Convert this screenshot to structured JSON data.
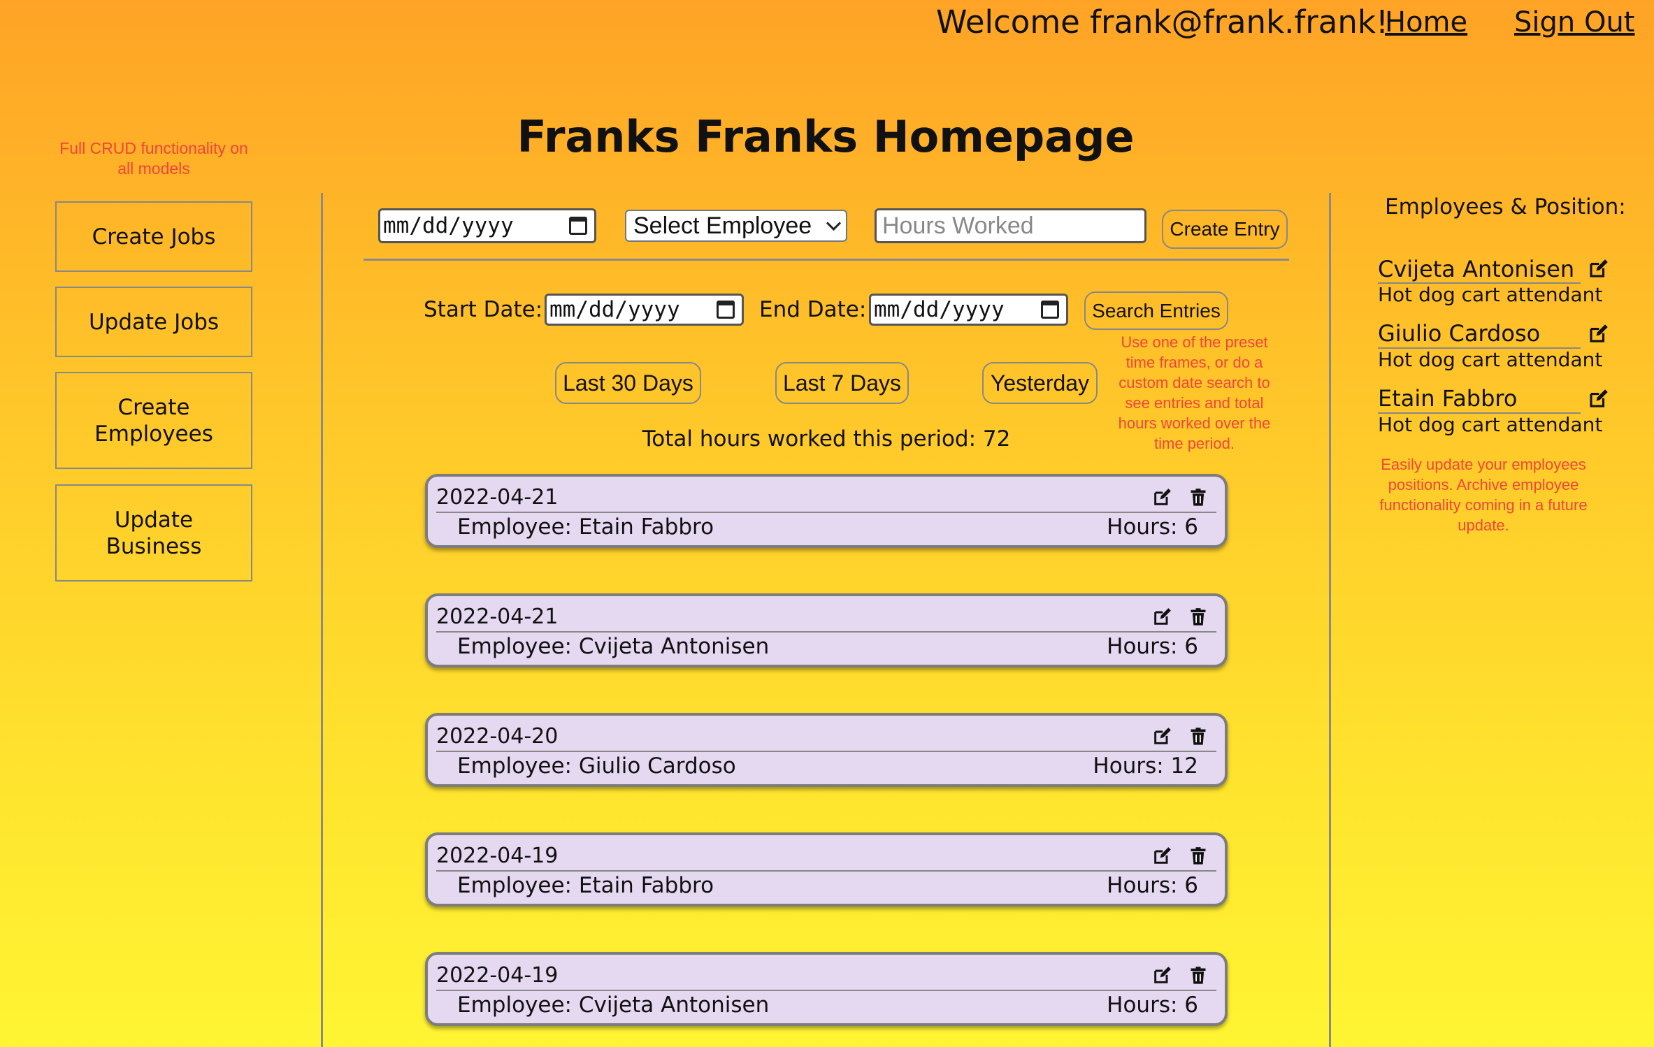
{
  "header": {
    "welcome": "Welcome frank@frank.frank!",
    "home_link": "Home",
    "signout_link": "Sign Out",
    "page_title": "Franks Franks Homepage"
  },
  "left_sidebar": {
    "note": "Full CRUD functionality on all models",
    "buttons": [
      {
        "label": "Create Jobs"
      },
      {
        "label": "Update Jobs"
      },
      {
        "label": "Create Employees"
      },
      {
        "label": "Update Business"
      }
    ]
  },
  "entry_form": {
    "date_placeholder": "mm/dd/yyyy",
    "employee_select": "Select Employee",
    "hours_placeholder": "Hours Worked",
    "submit_label": "Create Entry"
  },
  "search": {
    "start_label": "Start Date:",
    "end_label": "End Date:",
    "start_placeholder": "mm/dd/yyyy",
    "end_placeholder": "mm/dd/yyyy",
    "search_label": "Search Entries",
    "presets": [
      "Last 30 Days",
      "Last 7 Days",
      "Yesterday"
    ],
    "note": "Use one of the preset time frames, or do a custom date search to see entries and total hours worked over the time period.",
    "total_text": "Total hours worked this period: 72"
  },
  "entries": [
    {
      "date": "2022-04-21",
      "employee": "Employee: Etain Fabbro",
      "hours": "Hours: 6"
    },
    {
      "date": "2022-04-21",
      "employee": "Employee: Cvijeta Antonisen",
      "hours": "Hours: 6"
    },
    {
      "date": "2022-04-20",
      "employee": "Employee: Giulio Cardoso",
      "hours": "Hours: 12"
    },
    {
      "date": "2022-04-19",
      "employee": "Employee: Etain Fabbro",
      "hours": "Hours: 6"
    },
    {
      "date": "2022-04-19",
      "employee": "Employee: Cvijeta Antonisen",
      "hours": "Hours: 6"
    }
  ],
  "right_sidebar": {
    "heading": "Employees & Position:",
    "employees": [
      {
        "name": "Cvijeta Antonisen",
        "position": "Hot dog cart attendant"
      },
      {
        "name": "Giulio Cardoso",
        "position": "Hot dog cart attendant"
      },
      {
        "name": "Etain Fabbro",
        "position": "Hot dog cart attendant"
      }
    ],
    "note": "Easily update your employees positions.  Archive employee functionality coming in a future update."
  },
  "colors": {
    "accent_note": "#f0453a",
    "card_bg": "#e5d9f2",
    "bg_top": "#ffa326",
    "bg_bottom": "#fff533"
  }
}
